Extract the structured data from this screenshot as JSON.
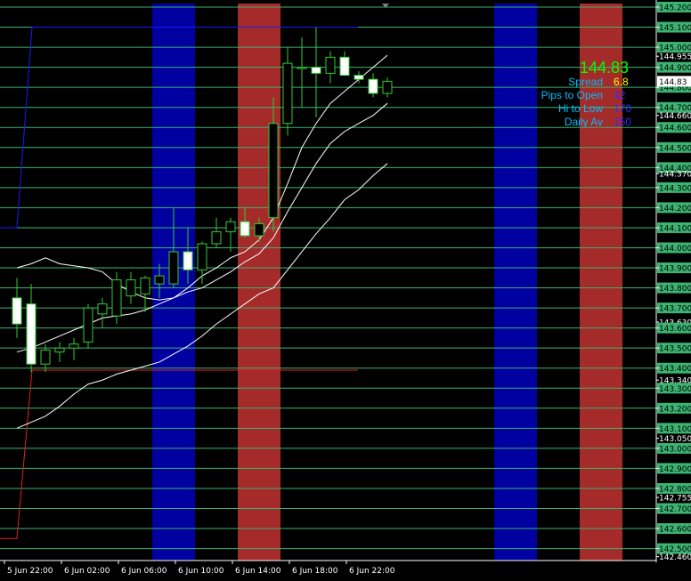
{
  "chart_data": {
    "type": "candlestick",
    "x_ticks": [
      "5 Jun 22:00",
      "6 Jun 02:00",
      "6 Jun 06:00",
      "6 Jun 10:00",
      "6 Jun 14:00",
      "6 Jun 18:00",
      "6 Jun 22:00"
    ],
    "y_ticks": [
      "145.200",
      "145.100",
      "145.000",
      "144.955",
      "144.900",
      "144.800",
      "144.700",
      "144.660",
      "144.600",
      "144.500",
      "144.400",
      "144.370",
      "144.300",
      "144.200",
      "144.100",
      "144.000",
      "143.900",
      "143.800",
      "143.700",
      "143.630",
      "143.600",
      "143.500",
      "143.400",
      "143.340",
      "143.300",
      "143.200",
      "143.100",
      "143.050",
      "143.000",
      "142.900",
      "142.800",
      "142.755",
      "142.700",
      "142.600",
      "142.500",
      "142.460"
    ],
    "y_scale": {
      "anchor_price": 145.2,
      "anchor_label_index": 0,
      "end_price": 142.46
    },
    "candles": [
      {
        "o": 143.75,
        "h": 143.85,
        "l": 143.55,
        "c": 143.62
      },
      {
        "o": 143.72,
        "h": 143.82,
        "l": 143.38,
        "c": 143.42
      },
      {
        "o": 143.42,
        "h": 143.52,
        "l": 143.38,
        "c": 143.49
      },
      {
        "o": 143.48,
        "h": 143.53,
        "l": 143.43,
        "c": 143.5
      },
      {
        "o": 143.5,
        "h": 143.55,
        "l": 143.44,
        "c": 143.52
      },
      {
        "o": 143.53,
        "h": 143.72,
        "l": 143.5,
        "c": 143.7
      },
      {
        "o": 143.67,
        "h": 143.75,
        "l": 143.6,
        "c": 143.72
      },
      {
        "o": 143.66,
        "h": 143.88,
        "l": 143.62,
        "c": 143.84
      },
      {
        "o": 143.76,
        "h": 143.88,
        "l": 143.72,
        "c": 143.84
      },
      {
        "o": 143.77,
        "h": 143.86,
        "l": 143.68,
        "c": 143.85
      },
      {
        "o": 143.82,
        "h": 143.92,
        "l": 143.75,
        "c": 143.86
      },
      {
        "o": 143.82,
        "h": 144.2,
        "l": 143.8,
        "c": 143.98
      },
      {
        "o": 143.98,
        "h": 144.1,
        "l": 143.82,
        "c": 143.89
      },
      {
        "o": 143.89,
        "h": 144.03,
        "l": 143.82,
        "c": 144.02
      },
      {
        "o": 144.02,
        "h": 144.15,
        "l": 144.0,
        "c": 144.08
      },
      {
        "o": 144.08,
        "h": 144.15,
        "l": 143.98,
        "c": 144.13
      },
      {
        "o": 144.13,
        "h": 144.2,
        "l": 144.05,
        "c": 144.06
      },
      {
        "o": 144.06,
        "h": 144.15,
        "l": 144.03,
        "c": 144.12
      },
      {
        "o": 144.15,
        "h": 144.75,
        "l": 144.08,
        "c": 144.62
      },
      {
        "o": 144.62,
        "h": 145.0,
        "l": 144.56,
        "c": 144.92
      },
      {
        "o": 144.9,
        "h": 145.05,
        "l": 144.7,
        "c": 144.9
      },
      {
        "o": 144.9,
        "h": 145.1,
        "l": 144.65,
        "c": 144.87
      },
      {
        "o": 144.87,
        "h": 144.98,
        "l": 144.82,
        "c": 144.95
      },
      {
        "o": 144.95,
        "h": 144.98,
        "l": 144.86,
        "c": 144.86
      },
      {
        "o": 144.86,
        "h": 144.88,
        "l": 144.82,
        "c": 144.84
      },
      {
        "o": 144.84,
        "h": 144.87,
        "l": 144.75,
        "c": 144.77
      },
      {
        "o": 144.77,
        "h": 144.85,
        "l": 144.75,
        "c": 144.83
      }
    ],
    "bands": [
      {
        "color": "#0000a0",
        "from_index": 9.5,
        "to_index": 12.5
      },
      {
        "color": "#a52a2a",
        "from_index": 15.5,
        "to_index": 18.5
      },
      {
        "color": "#0000a0",
        "from_index": 33.5,
        "to_index": 36.5
      },
      {
        "color": "#a52a2a",
        "from_index": 39.5,
        "to_index": 42.5
      }
    ],
    "daily_high": {
      "value": 145.1,
      "color": "#1a1aff"
    },
    "daily_low": {
      "value": 143.39,
      "color": "#e02020"
    },
    "ma_lines": [
      [
        [
          0,
          143.9
        ],
        [
          1,
          143.92
        ],
        [
          2,
          143.95
        ],
        [
          3,
          143.92
        ],
        [
          4,
          143.91
        ],
        [
          5,
          143.9
        ],
        [
          6,
          143.88
        ],
        [
          7,
          143.82
        ],
        [
          8,
          143.78
        ],
        [
          9,
          143.75
        ],
        [
          10,
          143.74
        ],
        [
          11,
          143.75
        ],
        [
          12,
          143.8
        ],
        [
          13,
          143.86
        ],
        [
          14,
          143.9
        ],
        [
          15,
          143.95
        ],
        [
          16,
          143.98
        ],
        [
          17,
          144.04
        ],
        [
          18,
          144.15
        ],
        [
          19,
          144.32
        ],
        [
          20,
          144.5
        ],
        [
          21,
          144.62
        ],
        [
          22,
          144.72
        ],
        [
          23,
          144.78
        ],
        [
          24,
          144.84
        ],
        [
          25,
          144.9
        ],
        [
          26,
          144.96
        ]
      ],
      [
        [
          0,
          143.48
        ],
        [
          1,
          143.5
        ],
        [
          2,
          143.53
        ],
        [
          3,
          143.56
        ],
        [
          4,
          143.59
        ],
        [
          5,
          143.62
        ],
        [
          6,
          143.65
        ],
        [
          7,
          143.66
        ],
        [
          8,
          143.67
        ],
        [
          9,
          143.69
        ],
        [
          10,
          143.72
        ],
        [
          11,
          143.75
        ],
        [
          12,
          143.78
        ],
        [
          13,
          143.8
        ],
        [
          14,
          143.84
        ],
        [
          15,
          143.88
        ],
        [
          16,
          143.93
        ],
        [
          17,
          143.97
        ],
        [
          18,
          144.05
        ],
        [
          19,
          144.18
        ],
        [
          20,
          144.3
        ],
        [
          21,
          144.42
        ],
        [
          22,
          144.52
        ],
        [
          23,
          144.58
        ],
        [
          24,
          144.62
        ],
        [
          25,
          144.66
        ],
        [
          26,
          144.72
        ]
      ],
      [
        [
          0,
          143.1
        ],
        [
          1,
          143.13
        ],
        [
          2,
          143.16
        ],
        [
          3,
          143.21
        ],
        [
          4,
          143.27
        ],
        [
          5,
          143.32
        ],
        [
          6,
          143.34
        ],
        [
          7,
          143.37
        ],
        [
          8,
          143.39
        ],
        [
          9,
          143.41
        ],
        [
          10,
          143.43
        ],
        [
          11,
          143.47
        ],
        [
          12,
          143.51
        ],
        [
          13,
          143.56
        ],
        [
          14,
          143.62
        ],
        [
          15,
          143.67
        ],
        [
          16,
          143.72
        ],
        [
          17,
          143.77
        ],
        [
          18,
          143.8
        ],
        [
          19,
          143.89
        ],
        [
          20,
          143.98
        ],
        [
          21,
          144.07
        ],
        [
          22,
          144.15
        ],
        [
          23,
          144.24
        ],
        [
          24,
          144.29
        ],
        [
          25,
          144.36
        ],
        [
          26,
          144.42
        ]
      ]
    ]
  },
  "info": {
    "price": "144.83",
    "rows": [
      {
        "label": "Spread",
        "value": "6.8",
        "value_color": "#ffff00"
      },
      {
        "label": "Pips to Open",
        "value": "42",
        "value_color": "#3030ff"
      },
      {
        "label": "Hi to Low",
        "value": "170",
        "value_color": "#3030ff"
      },
      {
        "label": "Daily Av",
        "value": "150",
        "value_color": "#3030ff"
      }
    ],
    "label_color": "#00bfff",
    "price_color": "#00ff00"
  },
  "colors": {
    "background": "#000000",
    "grid": "#3cb371",
    "axis_text": "#ffffff",
    "candle_up_fill": "#000000",
    "candle_down_fill": "#ffffff",
    "candle_border": "#32cd32",
    "ma_line": "#ffffff",
    "price_tag_bg": "#ffffff"
  }
}
